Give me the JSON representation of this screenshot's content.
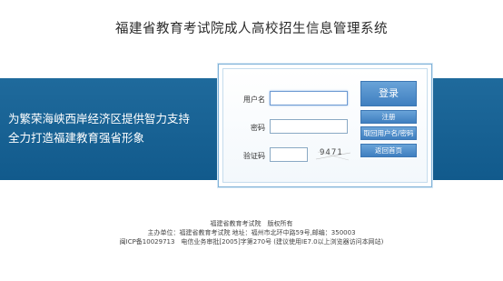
{
  "header": {
    "title": "福建省教育考试院成人高校招生信息管理系统"
  },
  "banner": {
    "line1": "为繁荣海峡西岸经济区提供智力支持",
    "line2": "全力打造福建教育强省形象"
  },
  "login": {
    "username_label": "用户名",
    "password_label": "密码",
    "captcha_label": "验证码",
    "username_value": "",
    "password_value": "",
    "captcha_value": "",
    "captcha_text": "9471",
    "login_button": "登录",
    "register_button": "注册",
    "retrieve_button": "取回用户名/密码",
    "home_button": "返回首页"
  },
  "footer": {
    "line1": "福建省教育考试院　版权所有",
    "line2": "主办单位：福建省教育考试院 地址：福州市北环中路59号,邮编：350003",
    "line3": "闽ICP备10029713　电信业务审批[2005]字第270号 (建议使用IE7.0以上浏览器访问本网站)"
  },
  "colors": {
    "banner": "#1a6698",
    "button": "#4f8ccb"
  }
}
